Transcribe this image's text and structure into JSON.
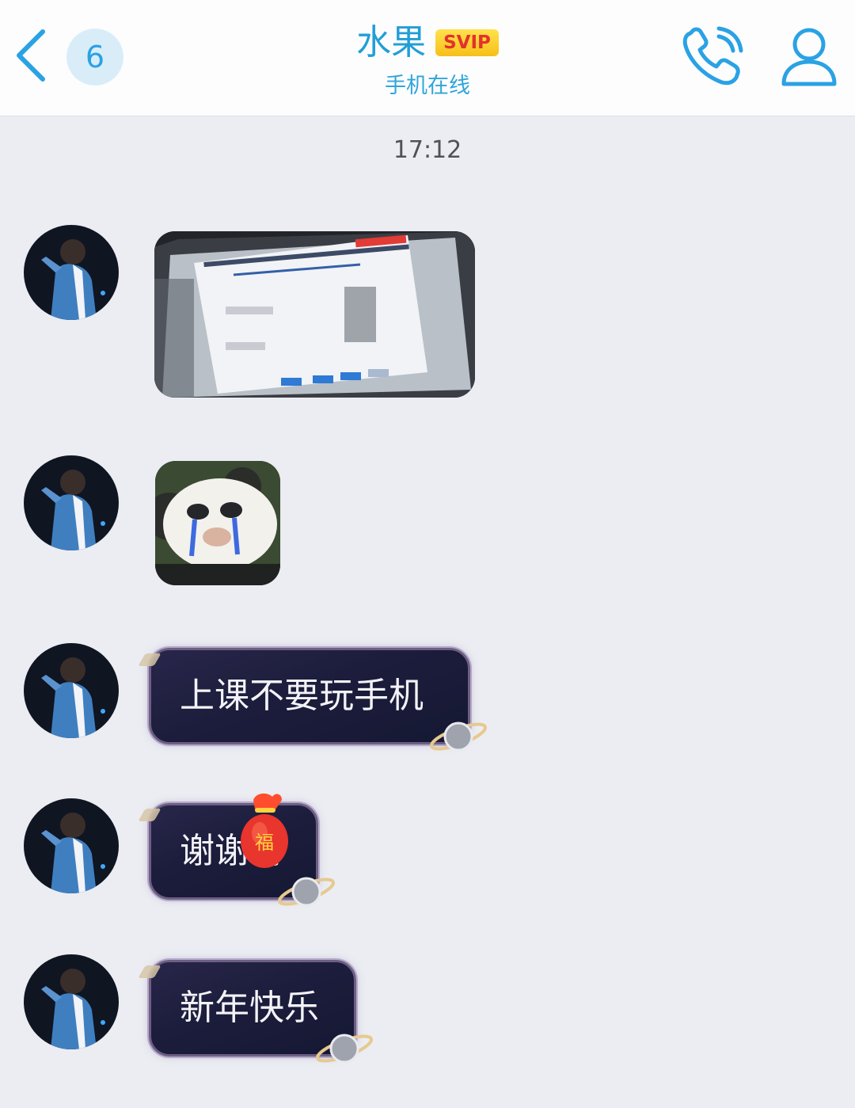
{
  "header": {
    "unread_count": "6",
    "contact_name": "水果",
    "vip_badge": "SVIP",
    "status": "手机在线"
  },
  "timestamp": "17:12",
  "messages": [
    {
      "type": "image"
    },
    {
      "type": "sticker"
    },
    {
      "type": "text",
      "text": "上课不要玩手机"
    },
    {
      "type": "text",
      "text": "谢谢哥"
    },
    {
      "type": "text",
      "text": "新年快乐"
    }
  ],
  "colors": {
    "accent": "#229ed6",
    "background": "#ebedf2",
    "bubble": "#1c1d3c",
    "vip_gold": "#f6bf18",
    "vip_text": "#e2322b"
  },
  "icons": {
    "back": "chevron-left-icon",
    "call": "phone-icon",
    "profile": "person-icon",
    "bubble_decoration": "planet-icon",
    "sticker_overlay": "fu-lucky-bag-icon"
  }
}
